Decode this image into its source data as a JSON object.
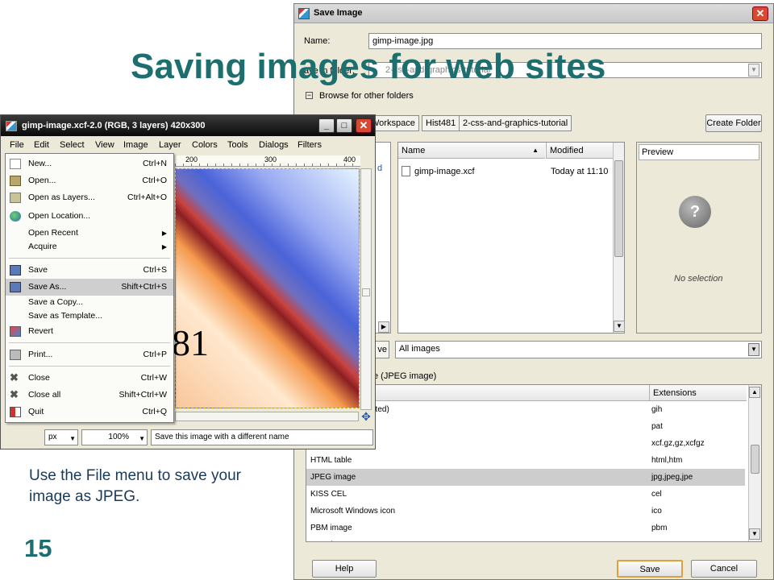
{
  "slide": {
    "title": "Saving images for web sites",
    "caption": "Use the File menu to save your image as JPEG.",
    "page_number": "15"
  },
  "save_dialog": {
    "title": "Save Image",
    "name_label": "Name:",
    "name_value": "gimp-image.jpg",
    "save_in_label": "ave in folder:",
    "save_in_value": "2-css-and-graphics-tutorial",
    "browse_label": "Browse for other folders",
    "path_buttons": [
      "Workspace",
      "Hist481",
      "2-css-and-graphics-tutorial"
    ],
    "create_folder": "Create Folder",
    "places_partial": "d",
    "columns": {
      "name": "Name",
      "modified": "Modified"
    },
    "files": [
      {
        "name": "gimp-image.xcf",
        "modified": "Today at 11:10"
      }
    ],
    "preview_label": "Preview",
    "no_selection": "No selection",
    "remove_partial": "ve",
    "filter_value": "All images",
    "file_type_label": "e (JPEG image)",
    "ext_header": "Extensions",
    "file_types": [
      {
        "name": "ated)",
        "ext": "gih"
      },
      {
        "name": "",
        "ext": "pat"
      },
      {
        "name": "",
        "ext": "xcf.gz,gz,xcfgz"
      },
      {
        "name": "HTML table",
        "ext": "html,htm"
      },
      {
        "name": "JPEG image",
        "ext": "jpg,jpeg,jpe",
        "selected": true
      },
      {
        "name": "KISS CEL",
        "ext": "cel"
      },
      {
        "name": "Microsoft Windows icon",
        "ext": "ico"
      },
      {
        "name": "PBM image",
        "ext": "pbm"
      },
      {
        "name": "PGM image",
        "ext": "pgm"
      }
    ],
    "help": "Help",
    "save": "Save",
    "cancel": "Cancel"
  },
  "gimp": {
    "title": "gimp-image.xcf-2.0 (RGB, 3 layers) 420x300",
    "menus": [
      "File",
      "Edit",
      "Select",
      "View",
      "Image",
      "Layer",
      "Colors",
      "Tools",
      "Dialogs",
      "Filters"
    ],
    "ruler_ticks": [
      "200",
      "300",
      "400"
    ],
    "canvas_text": "81",
    "unit": "px",
    "zoom": "100%",
    "status": "Save this image with a different name"
  },
  "file_menu": [
    {
      "label": "New...",
      "shortcut": "Ctrl+N",
      "icon": "new-doc-icon"
    },
    {
      "label": "Open...",
      "shortcut": "Ctrl+O",
      "icon": "folder-icon"
    },
    {
      "label": "Open as Layers...",
      "shortcut": "Ctrl+Alt+O",
      "icon": "layers-icon"
    },
    {
      "label": "Open Location...",
      "shortcut": "",
      "icon": "globe-icon"
    },
    {
      "label": "Open Recent",
      "shortcut": "",
      "submenu": true
    },
    {
      "label": "Acquire",
      "shortcut": "",
      "submenu": true
    },
    {
      "label": "Save",
      "shortcut": "Ctrl+S",
      "icon": "save-icon"
    },
    {
      "label": "Save As...",
      "shortcut": "Shift+Ctrl+S",
      "icon": "save-as-icon",
      "selected": true
    },
    {
      "label": "Save a Copy...",
      "shortcut": ""
    },
    {
      "label": "Save as Template...",
      "shortcut": ""
    },
    {
      "label": "Revert",
      "shortcut": "",
      "icon": "revert-icon"
    },
    {
      "label": "Print...",
      "shortcut": "Ctrl+P",
      "icon": "print-icon"
    },
    {
      "label": "Close",
      "shortcut": "Ctrl+W",
      "icon": "close-icon"
    },
    {
      "label": "Close all",
      "shortcut": "Shift+Ctrl+W",
      "icon": "close-all-icon"
    },
    {
      "label": "Quit",
      "shortcut": "Ctrl+Q",
      "icon": "quit-icon"
    }
  ]
}
